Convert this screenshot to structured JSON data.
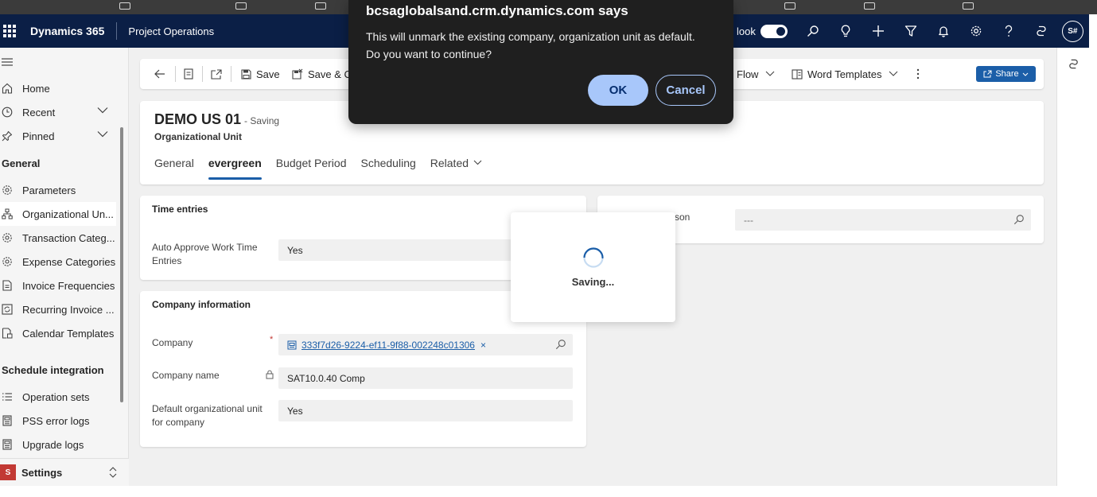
{
  "dialog": {
    "title": "bcsaglobalsand.crm.dynamics.com says",
    "message_line1": "This will unmark the existing company, organization unit as default.",
    "message_line2": "Do you want to continue?",
    "ok_label": "OK",
    "cancel_label": "Cancel"
  },
  "topnav": {
    "app_name": "Dynamics 365",
    "area_name": "Project Operations",
    "look_label": "look",
    "avatar_initials": "S#",
    "brand_color": "#0b1f46"
  },
  "sidebar": {
    "home": "Home",
    "recent": "Recent",
    "pinned": "Pinned",
    "general_header": "General",
    "general_items": [
      {
        "label": "Parameters",
        "icon": "gear-icon"
      },
      {
        "label": "Organizational Un...",
        "icon": "org-chart-icon"
      },
      {
        "label": "Transaction Categ...",
        "icon": "gear-icon"
      },
      {
        "label": "Expense Categories",
        "icon": "gear-icon"
      },
      {
        "label": "Invoice Frequencies",
        "icon": "document-list-icon"
      },
      {
        "label": "Recurring Invoice ...",
        "icon": "recurring-icon"
      },
      {
        "label": "Calendar Templates",
        "icon": "calendar-document-icon"
      }
    ],
    "schedule_header": "Schedule integration",
    "schedule_items": [
      {
        "label": "Operation sets",
        "icon": "list-icon"
      },
      {
        "label": "PSS error logs",
        "icon": "log-icon"
      },
      {
        "label": "Upgrade logs",
        "icon": "log-icon"
      }
    ],
    "area_switcher_badge": "S",
    "area_switcher_label": "Settings"
  },
  "commandbar": {
    "save": "Save",
    "save_close": "Save & Cl",
    "flow": "Flow",
    "word_templates": "Word Templates",
    "share": "Share"
  },
  "record": {
    "title": "DEMO US 01",
    "status": "- Saving",
    "entity": "Organizational Unit",
    "tabs": [
      "General",
      "evergreen",
      "Budget Period",
      "Scheduling",
      "Related"
    ],
    "active_tab": "evergreen"
  },
  "time_entries": {
    "title": "Time entries",
    "auto_approve_label_1": "Auto Approve Work Time",
    "auto_approve_label_2": "Entries",
    "auto_approve_value": "Yes"
  },
  "company_info": {
    "title": "Company information",
    "company_label": "Company",
    "required_marker": "*",
    "company_value": "333f7d26-9224-ef11-9f88-002248c01306",
    "company_remove": "×",
    "company_name_label": "Company name",
    "company_name_value": "SAT10.0.40 Comp",
    "default_label_1": "Default organizational unit",
    "default_label_2": "for company",
    "default_value": "Yes"
  },
  "right_card": {
    "label_fragment": "son",
    "value": "---"
  },
  "saving": {
    "text": "Saving..."
  }
}
